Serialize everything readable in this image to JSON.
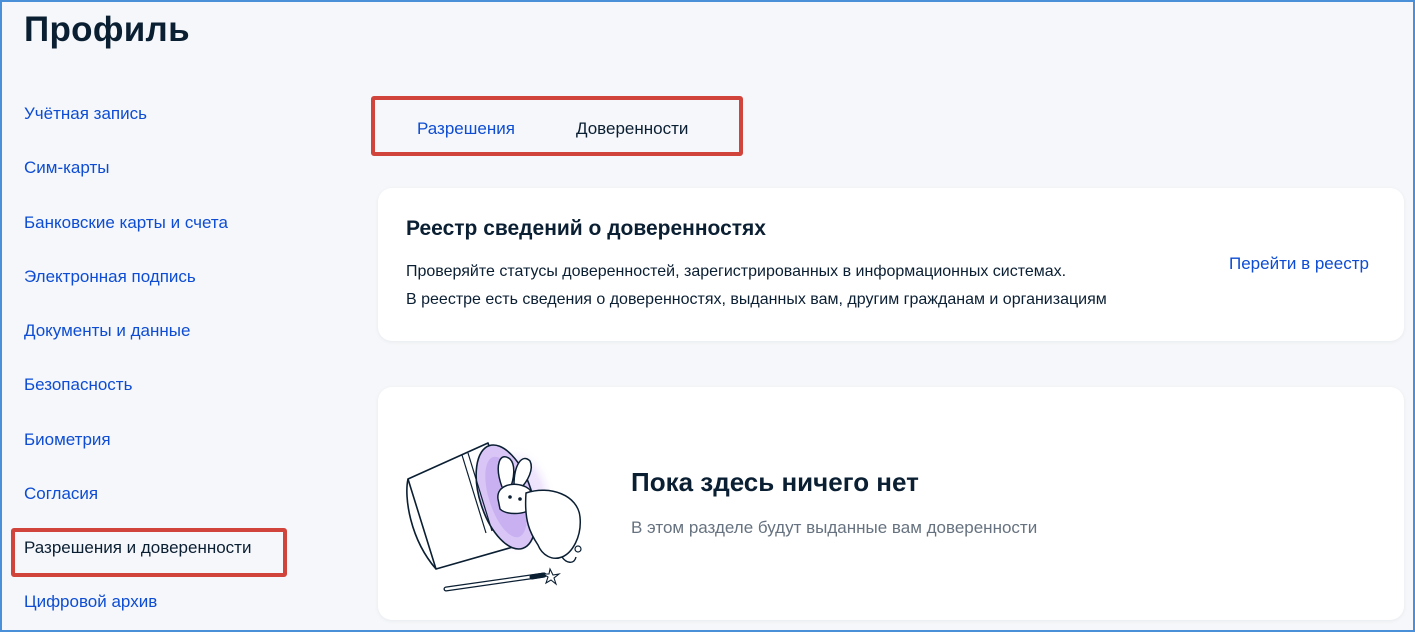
{
  "page": {
    "title": "Профиль"
  },
  "sidebar": {
    "items": [
      {
        "label": "Учётная запись",
        "active": false
      },
      {
        "label": "Сим-карты",
        "active": false
      },
      {
        "label": "Банковские карты и счета",
        "active": false
      },
      {
        "label": "Электронная подпись",
        "active": false
      },
      {
        "label": "Документы и данные",
        "active": false
      },
      {
        "label": "Безопасность",
        "active": false
      },
      {
        "label": "Биометрия",
        "active": false
      },
      {
        "label": "Согласия",
        "active": false
      },
      {
        "label": "Разрешения и доверенности",
        "active": true
      },
      {
        "label": "Цифровой архив",
        "active": false
      }
    ]
  },
  "tabs": [
    {
      "label": "Разрешения",
      "active": false
    },
    {
      "label": "Доверенности",
      "active": true
    }
  ],
  "registry_card": {
    "title": "Реестр сведений о доверенностях",
    "line1": "Проверяйте статусы доверенностей, зарегистрированных в информационных системах.",
    "line2": "В реестре есть сведения о доверенностях, выданных вам, другим гражданам и организациям",
    "link": "Перейти в реестр"
  },
  "empty_state": {
    "title": "Пока здесь ничего нет",
    "text": "В этом разделе будут выданные вам доверенности",
    "illustration": "magic-hat-rabbit-illustration"
  },
  "colors": {
    "link": "#0d4cd3",
    "text": "#0b1f33",
    "muted": "#66727f",
    "highlight": "#d0443b",
    "background": "#f5f7fa",
    "card": "#ffffff"
  }
}
